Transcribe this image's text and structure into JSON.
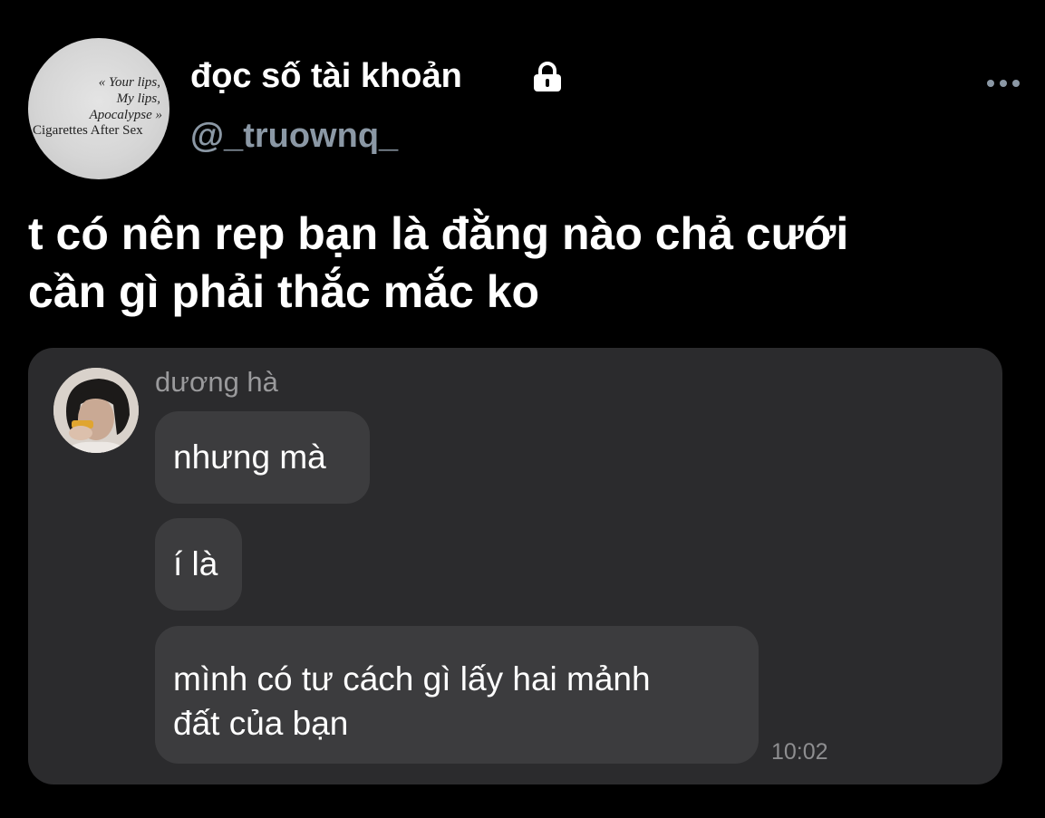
{
  "profile": {
    "display_name": "đọc số tài khoản",
    "handle": "@_truownq_",
    "avatar_quote_line1": "« Your lips,",
    "avatar_quote_line2": "My lips,",
    "avatar_quote_line3": "Apocalypse »",
    "avatar_band": "Cigarettes After Sex"
  },
  "icons": {
    "lock": "lock-icon",
    "more": "more-options-icon"
  },
  "tweet": {
    "text_line1": "t có nên rep bạn là đằng nào chả cưới",
    "text_line2": "cần gì phải thắc mắc ko"
  },
  "chat": {
    "sender_name": "dương hà",
    "messages": [
      {
        "lines": [
          "nhưng mà"
        ]
      },
      {
        "lines": [
          "í là"
        ]
      },
      {
        "lines": [
          "mình có tư cách gì lấy hai mảnh",
          "đất của bạn"
        ]
      }
    ],
    "timestamp": "10:02"
  },
  "colors": {
    "background": "#000000",
    "handle": "#8b98a5",
    "media_panel": "#2b2b2d",
    "bubble": "#3c3c3e",
    "muted_text": "#9a9a9c"
  }
}
